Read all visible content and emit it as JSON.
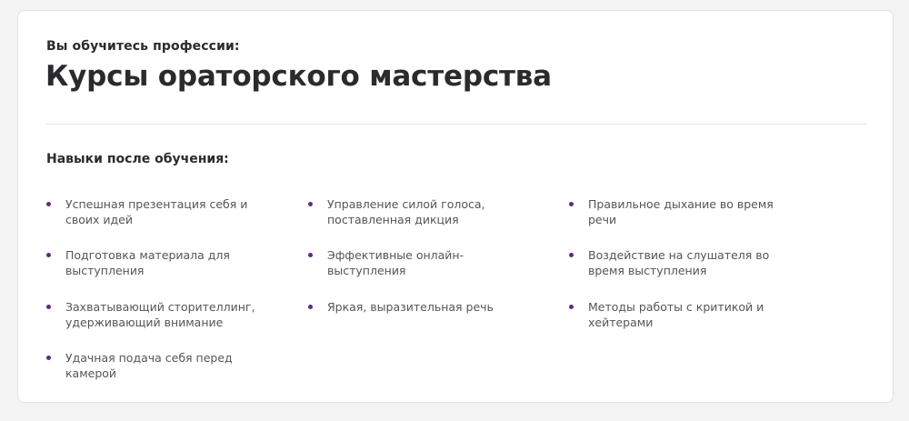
{
  "header": {
    "subtitle": "Вы обучитесь профессии:",
    "title": "Курсы ораторского мастерства"
  },
  "skills": {
    "heading": "Навыки после обучения:",
    "bullet_color": "#5b2a86",
    "items": [
      "Успешная презентация себя и своих идей",
      "Управление силой голоса, поставленная дикция",
      "Правильное дыхание во время речи",
      "Подготовка материала для выступления",
      "Эффективные онлайн-выступления",
      "Воздействие на слушателя во время выступления",
      "Захватывающий сторителлинг, удерживающий внимание",
      "Яркая, выразительная речь",
      "Методы работы с критикой и хейтерами",
      "Удачная подача себя перед камерой"
    ]
  }
}
